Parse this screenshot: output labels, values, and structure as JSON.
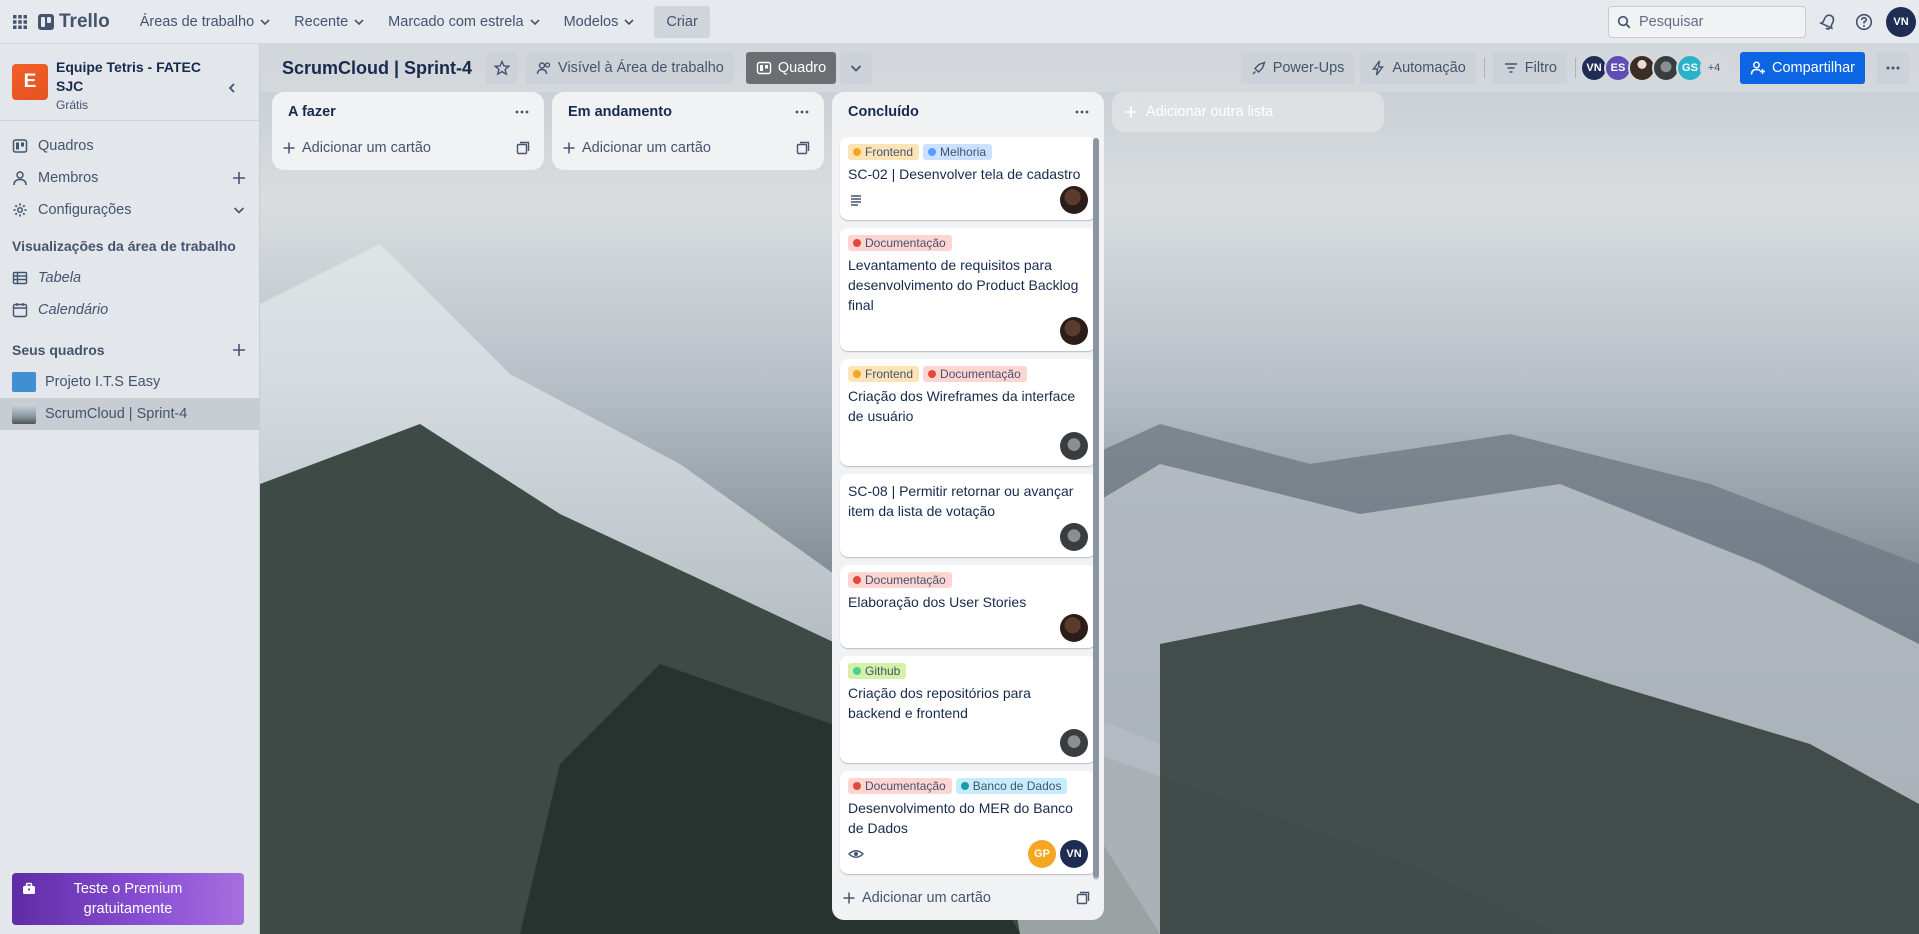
{
  "topnav": {
    "logo_text": "Trello",
    "menus": [
      "Áreas de trabalho",
      "Recente",
      "Marcado com estrela",
      "Modelos"
    ],
    "create_label": "Criar",
    "search_placeholder": "Pesquisar",
    "user_initials": "VN",
    "icons": [
      "apps-grid-icon",
      "notification-bell-icon",
      "help-icon"
    ]
  },
  "sidebar": {
    "workspace_initial": "E",
    "workspace_name": "Equipe Tetris - FATEC SJC",
    "workspace_plan": "Grátis",
    "items": [
      {
        "label": "Quadros",
        "icon": "board-icon"
      },
      {
        "label": "Membros",
        "icon": "person-icon"
      },
      {
        "label": "Configurações",
        "icon": "gear-icon"
      }
    ],
    "views_title": "Visualizações da área de trabalho",
    "views": [
      {
        "label": "Tabela",
        "icon": "table-icon"
      },
      {
        "label": "Calendário",
        "icon": "calendar-icon"
      }
    ],
    "boards_title": "Seus quadros",
    "boards": [
      {
        "label": "Projeto I.T.S Easy",
        "color": "#3f8fd2"
      },
      {
        "label": "ScrumCloud | Sprint-4",
        "color": "#9aa6b2"
      }
    ],
    "premium_label": "Teste o Premium gratuitamente"
  },
  "board": {
    "title": "ScrumCloud | Sprint-4",
    "visibility_label": "Visível à Área de trabalho",
    "view_label": "Quadro",
    "powerups_label": "Power-Ups",
    "automation_label": "Automação",
    "filter_label": "Filtro",
    "members": [
      {
        "initials": "VN",
        "color": "#1f2d54"
      },
      {
        "initials": "ES",
        "color": "#5e4db2"
      },
      {
        "initials": "",
        "color": "#3b2c24"
      },
      {
        "initials": "",
        "color": "#555a5f"
      },
      {
        "initials": "GS",
        "color": "#2ab2c9"
      }
    ],
    "more_members": "+4",
    "share_label": "Compartilhar"
  },
  "lists": [
    {
      "title": "A fazer",
      "add_label": "Adicionar um cartão"
    },
    {
      "title": "Em andamento",
      "add_label": "Adicionar um cartão"
    },
    {
      "title": "Concluído",
      "add_label": "Adicionar um cartão",
      "cards": [
        {
          "labels": [
            {
              "text": "Frontend",
              "bg": "#fce4b7",
              "dot": "#f5a623"
            },
            {
              "text": "Melhoria",
              "bg": "#cce0ff",
              "dot": "#579dff"
            }
          ],
          "title": "SC-02 | Desenvolver tela de cadastro",
          "badges": [
            "description-icon"
          ],
          "members": [
            "photo1"
          ]
        },
        {
          "labels": [
            {
              "text": "Documentação",
              "bg": "#ffd5d2",
              "dot": "#e2483d"
            }
          ],
          "title": "Levantamento de requisitos para desenvolvimento do Product Backlog final",
          "badges": [],
          "members": [
            "photo2"
          ]
        },
        {
          "labels": [
            {
              "text": "Frontend",
              "bg": "#fce4b7",
              "dot": "#f5a623"
            },
            {
              "text": "Documentação",
              "bg": "#ffd5d2",
              "dot": "#e2483d"
            }
          ],
          "title": "Criação dos Wireframes da interface de usuário",
          "badges": [],
          "members": [
            "photo3"
          ]
        },
        {
          "labels": [],
          "title": "SC-08 | Permitir retornar ou avançar item da lista de votação",
          "badges": [],
          "members": [
            "photo3"
          ]
        },
        {
          "labels": [
            {
              "text": "Documentação",
              "bg": "#ffd5d2",
              "dot": "#e2483d"
            }
          ],
          "title": "Elaboração dos User Stories",
          "badges": [],
          "members": [
            "photo2"
          ]
        },
        {
          "labels": [
            {
              "text": "Github",
              "bg": "#d3f1a7",
              "dot": "#4bce97"
            }
          ],
          "title": "Criação dos repositórios para backend e frontend",
          "badges": [],
          "members": [
            "photo3"
          ]
        },
        {
          "labels": [
            {
              "text": "Documentação",
              "bg": "#ffd5d2",
              "dot": "#e2483d"
            },
            {
              "text": "Banco de Dados",
              "bg": "#c6edfb",
              "dot": "#1d9aaa"
            }
          ],
          "title": "Desenvolvimento do MER do Banco de Dados",
          "badges": [
            "watch-eye-icon"
          ],
          "members": [
            "GP",
            "VN"
          ]
        }
      ]
    }
  ],
  "add_list_label": "Adicionar outra lista"
}
